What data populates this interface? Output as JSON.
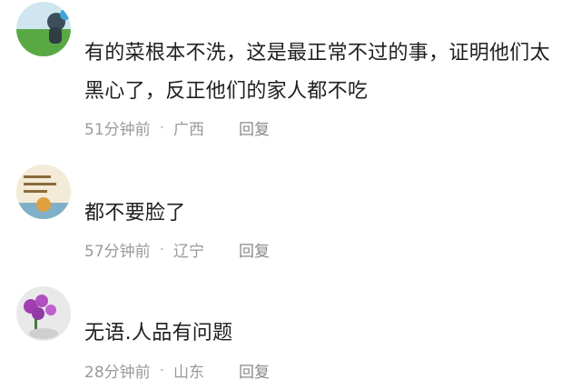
{
  "comments": [
    {
      "text": "有的菜根本不洗，这是最正常不过的事，证明他们太黑心了，反正他们的家人都不吃",
      "time": "51分钟前",
      "separator": "·",
      "region": "广西",
      "reply_label": "回复",
      "avatar_icon": "user-avatar-green-field"
    },
    {
      "text": "都不要脸了",
      "time": "57分钟前",
      "separator": "·",
      "region": "辽宁",
      "reply_label": "回复",
      "avatar_icon": "user-avatar-handwriting-card"
    },
    {
      "text": "无语.人品有问题",
      "time": "28分钟前",
      "separator": "·",
      "region": "山东",
      "reply_label": "回复",
      "avatar_icon": "user-avatar-purple-orchid"
    }
  ]
}
